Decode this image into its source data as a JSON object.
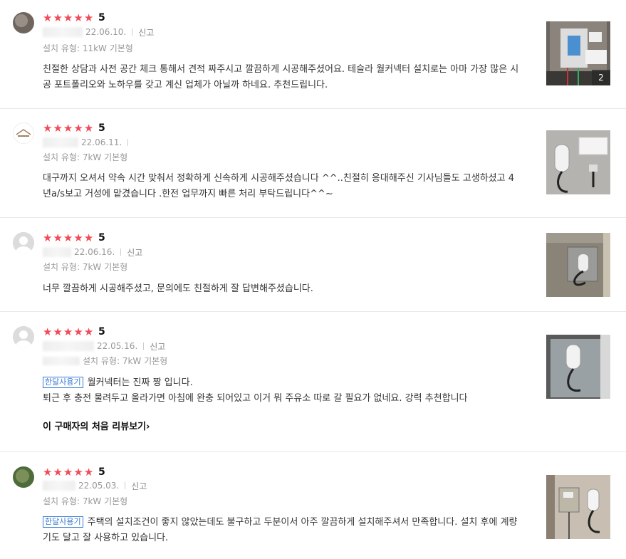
{
  "reviews": [
    {
      "rating": "5",
      "date": "22.06.10.",
      "report_label": "신고",
      "install_type": "설치 유형: 11kW 기본형",
      "text": "친절한 상담과 사전 공간 체크 통해서 견적 짜주시고 깔끔하게 시공해주셨어요. 테슬라 월커넥터 설치로는 아마 가장 많은 시공 포트폴리오와 노하우를 갖고 계신 업체가 아닐까 하네요. 추천드립니다.",
      "photo_count": "2",
      "avatar_icon": "user-photo-icon"
    },
    {
      "rating": "5",
      "date": "22.06.11.",
      "report_label": "",
      "install_type": "설치 유형: 7kW 기본형",
      "text": "대구까지 오셔서 약속 시간 맞춰서 정확하게 신속하게 시공해주셨습니다 ^^..친절히 응대해주신 기사님들도 고생하셨고 4년a/s보고 거성에 맡겼습니다 .한전 업무까지 빠른 처리 부탁드립니다^^~",
      "avatar_icon": "company-logo-icon"
    },
    {
      "rating": "5",
      "date": "22.06.16.",
      "report_label": "신고",
      "install_type": "설치 유형: 7kW 기본형",
      "text": "너무 깔끔하게 시공해주셨고, 문의에도 친절하게 잘 답변해주셨습니다.",
      "avatar_icon": "default-user-icon"
    },
    {
      "rating": "5",
      "date": "22.05.16.",
      "report_label": "신고",
      "install_type": "설치 유형: 7kW 기본형",
      "badge": "한달사용기",
      "text_line1": "월커넥터는 진짜 짱 입니다.",
      "text_line2": "퇴근 후 충전 물려두고 올라가면 아침에 완충 되어있고 이거 뭐 주유소 따로 갈 필요가 없네요. 강력 추천합니다",
      "first_review_link": "이 구매자의 처음 리뷰보기",
      "avatar_icon": "default-user-icon"
    },
    {
      "rating": "5",
      "date": "22.05.03.",
      "report_label": "신고",
      "install_type": "설치 유형: 7kW 기본형",
      "badge": "한달사용기",
      "text": "주택의 설치조건이 좋지 않았는데도 불구하고 두분이서 아주 깔끔하게 설치해주셔서 만족합니다. 설치 후에 계량기도 달고 잘 사용하고 있습니다.",
      "avatar_icon": "user-photo-icon"
    }
  ],
  "colors": {
    "star": "#f24a57",
    "badge": "#3b7bd4",
    "meta": "#999999"
  }
}
